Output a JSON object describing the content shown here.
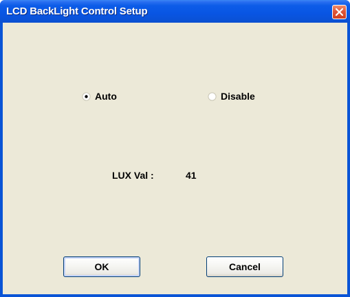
{
  "window": {
    "title": "LCD BackLight Control Setup"
  },
  "mode": {
    "options": [
      {
        "label": "Auto",
        "selected": true
      },
      {
        "label": "Disable",
        "selected": false
      }
    ]
  },
  "lux": {
    "label": "LUX Val :",
    "value": "41"
  },
  "buttons": {
    "ok_label": "OK",
    "cancel_label": "Cancel"
  },
  "colors": {
    "titlebar": "#0a54d6",
    "dialog_background": "#ece9d8",
    "close_button": "#e0563a"
  },
  "icons": {
    "close": "close-icon"
  }
}
